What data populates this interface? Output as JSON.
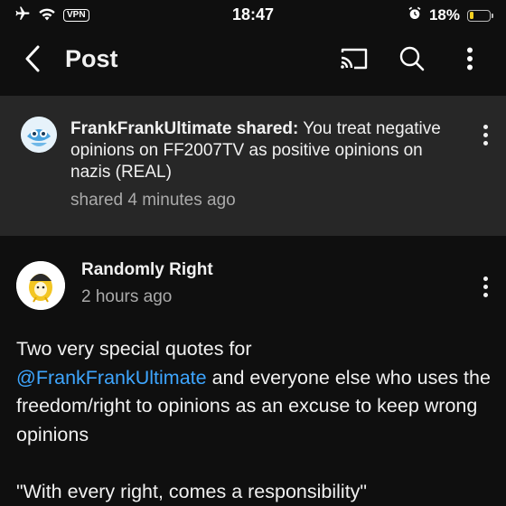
{
  "status_bar": {
    "vpn_label": "VPN",
    "time": "18:47",
    "battery_percent": "18%",
    "battery_level": 0.18,
    "icons": [
      "airplane-icon",
      "wifi-icon",
      "alarm-icon",
      "battery-icon"
    ],
    "battery_color": "#f5d020"
  },
  "app_bar": {
    "title": "Post",
    "icons": [
      "back-chevron-icon",
      "cast-icon",
      "search-icon",
      "more-vertical-icon"
    ]
  },
  "shared_post": {
    "sharer": "FrankFrankUltimate shared:",
    "text": " You treat negative opinions on FF2007TV as positive opinions on nazis (REAL)",
    "time": "shared 4 minutes ago"
  },
  "post": {
    "author": "Randomly Right",
    "time": "2 hours ago",
    "body_line1": "Two very special quotes for",
    "mention": "@FrankFrankUltimate",
    "body_rest": " and everyone else who uses the freedom/right to opinions as an excuse to keep wrong opinions",
    "quote": "\"With every right, comes a responsibility\""
  },
  "colors": {
    "background": "#0f0f0f",
    "card": "#272727",
    "mention": "#3ea6ff",
    "secondary_text": "#aaaaaa"
  }
}
